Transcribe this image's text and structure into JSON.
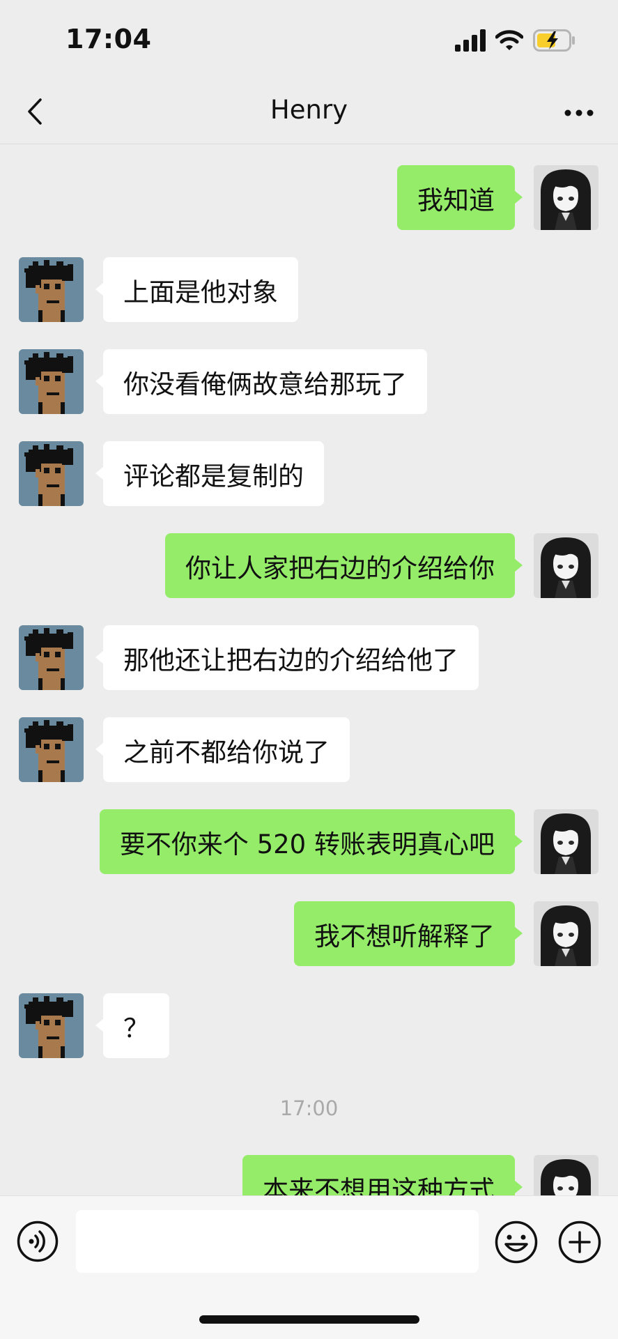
{
  "status_bar": {
    "time": "17:04"
  },
  "header": {
    "title": "Henry"
  },
  "messages": [
    {
      "side": "right",
      "text": "我知道"
    },
    {
      "side": "left",
      "text": "上面是他对象"
    },
    {
      "side": "left",
      "text": "你没看俺俩故意给那玩了"
    },
    {
      "side": "left",
      "text": "评论都是复制的"
    },
    {
      "side": "right",
      "text": "你让人家把右边的介绍给你"
    },
    {
      "side": "left",
      "text": "那他还让把右边的介绍给他了"
    },
    {
      "side": "left",
      "text": "之前不都给你说了"
    },
    {
      "side": "right",
      "text": "要不你来个 520 转账表明真心吧"
    },
    {
      "side": "right",
      "text": "我不想听解释了"
    },
    {
      "side": "left",
      "text": "？"
    },
    {
      "side": "right",
      "text": "本来不想用这种方式"
    }
  ],
  "timestamp": "17:00",
  "input_bar": {
    "value": ""
  },
  "colors": {
    "background": "#ededed",
    "sent_bubble": "#95ec69",
    "received_bubble": "#ffffff",
    "battery_fill": "#f7ce2c",
    "contact_avatar_bg": "#6a8aa0",
    "contact_avatar_skin": "#a9794e"
  },
  "icons": {
    "back": "chevron-left-icon",
    "more": "more-dots-icon",
    "voice": "voice-icon",
    "emoji": "emoji-icon",
    "plus": "plus-icon",
    "signal": "signal-icon",
    "wifi": "wifi-icon",
    "battery": "battery-charging-icon"
  }
}
